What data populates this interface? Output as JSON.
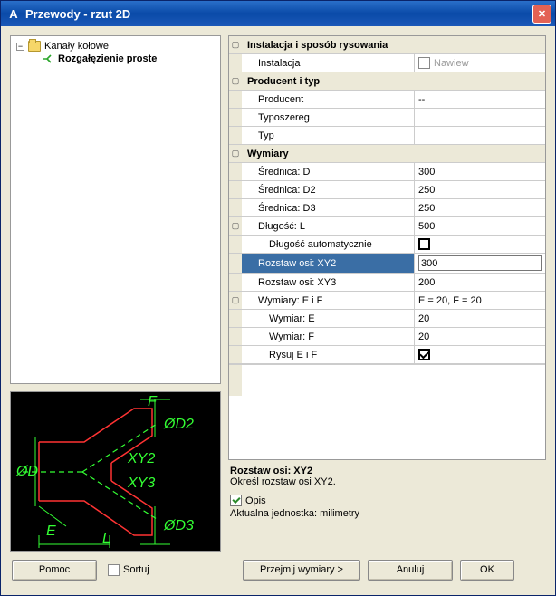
{
  "window": {
    "title": "Przewody - rzut 2D",
    "app_icon": "A"
  },
  "tree": {
    "root_label": "Kanały kołowe",
    "child_label": "Rozgałęzienie proste"
  },
  "grid": {
    "sec1_header": "Instalacja i sposób rysowania",
    "instalacja_key": "Instalacja",
    "instalacja_val": "Nawiew",
    "sec2_header": "Producent i typ",
    "producent_key": "Producent",
    "producent_val": "--",
    "typoszereg_key": "Typoszereg",
    "typoszereg_val": "",
    "typ_key": "Typ",
    "typ_val": "",
    "sec3_header": "Wymiary",
    "sred_d_key": "Średnica: D",
    "sred_d_val": "300",
    "sred_d2_key": "Średnica: D2",
    "sred_d2_val": "250",
    "sred_d3_key": "Średnica: D3",
    "sred_d3_val": "250",
    "dl_l_key": "Długość: L",
    "dl_l_val": "500",
    "dl_auto_key": "Długość automatycznie",
    "xy2_key": "Rozstaw osi: XY2",
    "xy2_val": "300",
    "xy3_key": "Rozstaw osi: XY3",
    "xy3_val": "200",
    "eif_key": "Wymiary: E i F",
    "eif_val": "E = 20,  F = 20",
    "we_key": "Wymiar: E",
    "we_val": "20",
    "wf_key": "Wymiar: F",
    "wf_val": "20",
    "rysuj_key": "Rysuj E i F"
  },
  "desc": {
    "title": "Rozstaw osi: XY2",
    "text": "Określ rozstaw osi XY2."
  },
  "right_footer": {
    "opis_label": "Opis",
    "unit_label": "Aktualna jednostka: milimetry"
  },
  "buttons": {
    "help": "Pomoc",
    "sort": "Sortuj",
    "accept": "Przejmij wymiary  >",
    "cancel": "Anuluj",
    "ok": "OK"
  }
}
